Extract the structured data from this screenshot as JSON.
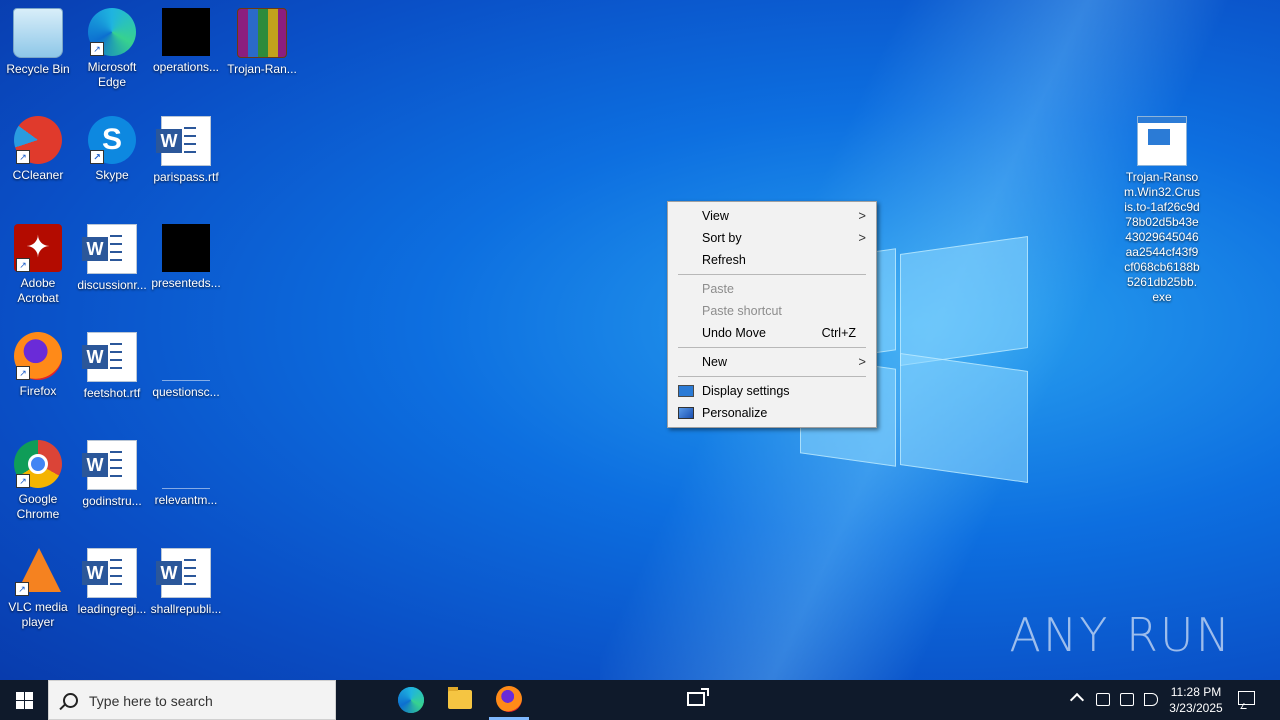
{
  "desktop": {
    "icons": [
      {
        "label": "Recycle Bin",
        "icon": "recycle-bin-icon"
      },
      {
        "label": "Microsoft Edge",
        "icon": "edge-icon"
      },
      {
        "label": "operations...",
        "icon": "black-file-icon"
      },
      {
        "label": "Trojan-Ran...",
        "icon": "winrar-archive-icon"
      },
      {
        "label": "CCleaner",
        "icon": "ccleaner-icon"
      },
      {
        "label": "Skype",
        "icon": "skype-icon"
      },
      {
        "label": "parispass.rtf",
        "icon": "word-document-icon"
      },
      {
        "label": "Adobe Acrobat",
        "icon": "acrobat-icon"
      },
      {
        "label": "discussionr...",
        "icon": "word-document-icon"
      },
      {
        "label": "presenteds...",
        "icon": "black-file-icon"
      },
      {
        "label": "Firefox",
        "icon": "firefox-icon"
      },
      {
        "label": "feetshot.rtf",
        "icon": "word-document-icon"
      },
      {
        "label": "questionsc...",
        "icon": "blank-file-icon"
      },
      {
        "label": "Google Chrome",
        "icon": "chrome-icon"
      },
      {
        "label": "godinstru...",
        "icon": "word-document-icon"
      },
      {
        "label": "relevantm...",
        "icon": "blank-file-icon"
      },
      {
        "label": "VLC media player",
        "icon": "vlc-icon"
      },
      {
        "label": "leadingregi...",
        "icon": "word-document-icon"
      },
      {
        "label": "shallrepubli...",
        "icon": "word-document-icon"
      }
    ],
    "exe_file": {
      "label": "Trojan-Ransom.Win32.Crusis.to-1af26c9d78b02d5b43e43029645046aa2544cf43f9cf068cb6188b5261db25bb.exe",
      "icon": "executable-icon"
    },
    "watermark": "ANY RUN"
  },
  "context_menu": {
    "items": [
      {
        "label": "View",
        "submenu": true,
        "disabled": false
      },
      {
        "label": "Sort by",
        "submenu": true,
        "disabled": false
      },
      {
        "label": "Refresh",
        "disabled": false
      },
      {
        "label": "Paste",
        "disabled": true
      },
      {
        "label": "Paste shortcut",
        "disabled": true
      },
      {
        "label": "Undo Move",
        "shortcut": "Ctrl+Z",
        "disabled": false
      },
      {
        "label": "New",
        "submenu": true,
        "disabled": false
      },
      {
        "label": "Display settings",
        "icon": "display-settings-icon",
        "disabled": false
      },
      {
        "label": "Personalize",
        "icon": "personalize-icon",
        "disabled": false
      }
    ],
    "arrow": ">"
  },
  "taskbar": {
    "search_placeholder": "Type here to search",
    "pinned": [
      "task-view-icon",
      "edge-icon",
      "file-explorer-icon",
      "firefox-icon"
    ],
    "tray": [
      "show-hidden-icons-chevron",
      "network-icon",
      "monitor-icon",
      "volume-icon"
    ],
    "time": "11:28 PM",
    "date": "3/23/2025"
  },
  "colors": {
    "desktop_blue": "#0d6fe0",
    "taskbar": "#0f1a2b",
    "menu_bg": "#f2f2f2",
    "disabled_text": "#8d8d8d"
  }
}
